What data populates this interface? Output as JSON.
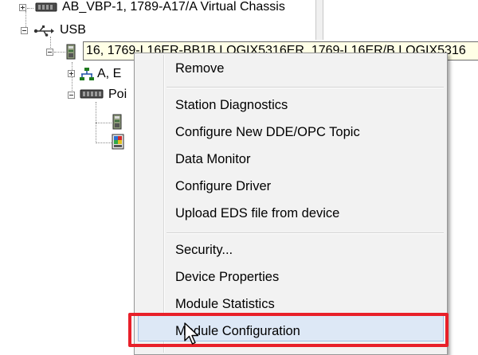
{
  "tree": {
    "items": [
      {
        "label": "AB_VBP-1, 1789-A17/A Virtual Chassis",
        "icon": "chassis-icon",
        "expander": "plus"
      },
      {
        "label": "USB",
        "icon": "usb-icon",
        "expander": "minus"
      },
      {
        "label": "16, 1769-L16ER-BB1B LOGIX5316ER, 1769-L16ER/B LOGIX5316",
        "icon": "controller-icon",
        "expander": "minus",
        "selected": true
      },
      {
        "label": "A, E",
        "icon": "ethernet-network-icon",
        "expander": "plus"
      },
      {
        "label": "Poi",
        "icon": "point-io-chassis-icon",
        "expander": "minus"
      },
      {
        "label": "",
        "icon": "module-icon"
      },
      {
        "label": "",
        "icon": "colored-module-icon"
      }
    ]
  },
  "context_menu": {
    "groups": [
      [
        "Remove"
      ],
      [
        "Station Diagnostics",
        "Configure New DDE/OPC Topic",
        "Data Monitor",
        "Configure Driver",
        "Upload EDS file from device"
      ],
      [
        "Security...",
        "Device Properties",
        "Module Statistics",
        "Module Configuration"
      ]
    ],
    "highlighted_item": "Module Configuration"
  },
  "colors": {
    "annotation_red": "#e8202a",
    "highlight_fill": "#dde8f6",
    "selection_fill": "#ffffe6",
    "menu_bg": "#f2f2f2"
  }
}
